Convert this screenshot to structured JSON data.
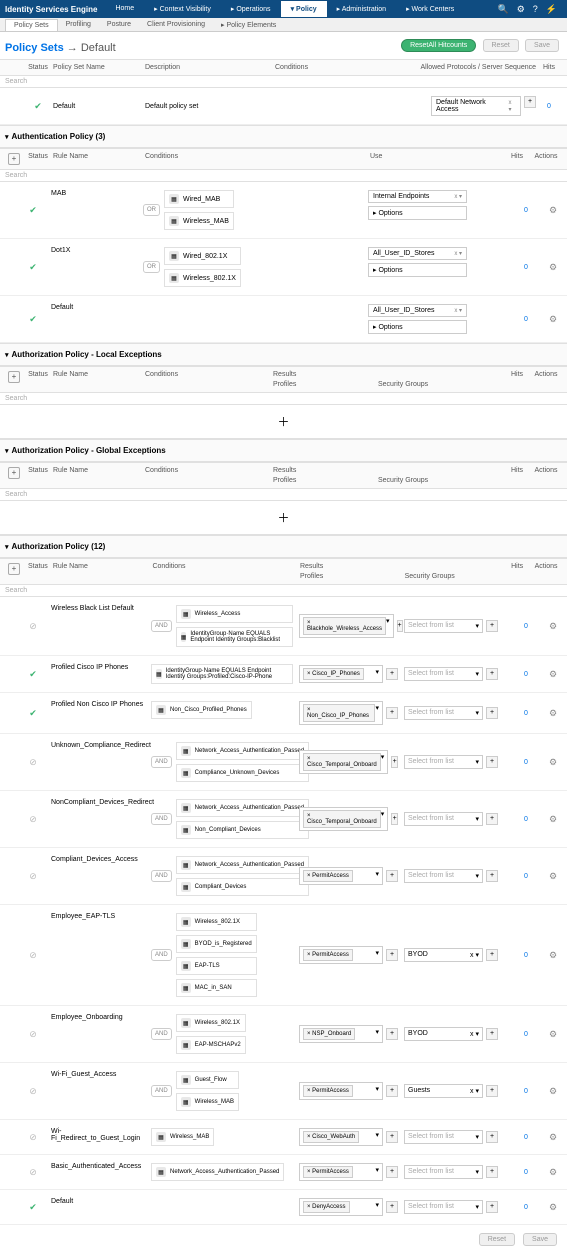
{
  "topbar": {
    "product": "Identity Services Engine",
    "nav": [
      "Home",
      "▸ Context Visibility",
      "▸ Operations",
      "▾ Policy",
      "▸ Administration",
      "▸ Work Centers"
    ]
  },
  "subnav": [
    "Policy Sets",
    "Profiling",
    "Posture",
    "Client Provisioning",
    "▸ Policy Elements"
  ],
  "title": {
    "main": "Policy Sets",
    "arrow": "→",
    "sub": "Default"
  },
  "buttons": {
    "resetHit": "ResetAll Hitcounts",
    "reset": "Reset",
    "save": "Save"
  },
  "headers": {
    "status": "Status",
    "psName": "Policy Set Name",
    "desc": "Description",
    "cond": "Conditions",
    "allowed": "Allowed Protocols / Server Sequence",
    "hits": "Hits",
    "ruleName": "Rule Name",
    "use": "Use",
    "actions": "Actions",
    "results": "Results",
    "profiles": "Profiles",
    "secGroups": "Security Groups",
    "search": "Search"
  },
  "defaultRow": {
    "name": "Default",
    "desc": "Default policy set",
    "allowed": "Default Network Access",
    "hits": "0"
  },
  "sections": {
    "authPolicy": "Authentication Policy (3)",
    "localEx": "Authorization Policy - Local Exceptions",
    "globalEx": "Authorization Policy - Global Exceptions",
    "authzPolicy": "Authorization Policy (12)"
  },
  "authRules": [
    {
      "name": "MAB",
      "conds": [
        "Wired_MAB",
        "Wireless_MAB"
      ],
      "op": "OR",
      "use": "Internal Endpoints",
      "options": "▸ Options",
      "hits": "0"
    },
    {
      "name": "Dot1X",
      "conds": [
        "Wired_802.1X",
        "Wireless_802.1X"
      ],
      "op": "OR",
      "use": "All_User_ID_Stores",
      "options": "▸ Options",
      "hits": "0"
    },
    {
      "name": "Default",
      "conds": [],
      "op": "",
      "use": "All_User_ID_Stores",
      "options": "▸ Options",
      "hits": "0"
    }
  ],
  "authzRules": [
    {
      "status": "gray",
      "name": "Wireless Black List Default",
      "op": "AND",
      "conds": [
        "Wireless_Access",
        "IdentityGroup·Name EQUALS Endpoint Identity Groups:Blacklist"
      ],
      "profile": "× Blackhole_Wireless_Access",
      "sec": "Select from list",
      "hits": "0"
    },
    {
      "status": "green",
      "name": "Profiled Cisco IP Phones",
      "op": "",
      "conds": [
        "IdentityGroup·Name EQUALS Endpoint Identity Groups:Profiled:Cisco-IP-Phone"
      ],
      "profile": "× Cisco_IP_Phones",
      "sec": "Select from list",
      "hits": "0"
    },
    {
      "status": "green",
      "name": "Profiled Non Cisco IP Phones",
      "op": "",
      "conds": [
        "Non_Cisco_Profiled_Phones"
      ],
      "profile": "× Non_Cisco_IP_Phones",
      "sec": "Select from list",
      "hits": "0"
    },
    {
      "status": "gray",
      "name": "Unknown_Compliance_Redirect",
      "op": "AND",
      "conds": [
        "Network_Access_Authentication_Passed",
        "Compliance_Unknown_Devices"
      ],
      "profile": "× Cisco_Temporal_Onboard",
      "sec": "Select from list",
      "hits": "0"
    },
    {
      "status": "gray",
      "name": "NonCompliant_Devices_Redirect",
      "op": "AND",
      "conds": [
        "Network_Access_Authentication_Passed",
        "Non_Compliant_Devices"
      ],
      "profile": "× Cisco_Temporal_Onboard",
      "sec": "Select from list",
      "hits": "0"
    },
    {
      "status": "gray",
      "name": "Compliant_Devices_Access",
      "op": "AND",
      "conds": [
        "Network_Access_Authentication_Passed",
        "Compliant_Devices"
      ],
      "profile": "× PermitAccess",
      "sec": "Select from list",
      "hits": "0"
    },
    {
      "status": "gray",
      "name": "Employee_EAP-TLS",
      "op": "AND",
      "conds": [
        "Wireless_802.1X",
        "BYOD_is_Registered",
        "EAP-TLS",
        "MAC_in_SAN"
      ],
      "profile": "× PermitAccess",
      "sec": "BYOD",
      "secClear": true,
      "hits": "0"
    },
    {
      "status": "gray",
      "name": "Employee_Onboarding",
      "op": "AND",
      "conds": [
        "Wireless_802.1X",
        "EAP-MSCHAPv2"
      ],
      "profile": "× NSP_Onboard",
      "sec": "BYOD",
      "secClear": true,
      "hits": "0"
    },
    {
      "status": "gray",
      "name": "Wi-Fi_Guest_Access",
      "op": "AND",
      "conds": [
        "Guest_Flow",
        "Wireless_MAB"
      ],
      "profile": "× PermitAccess",
      "sec": "Guests",
      "secClear": true,
      "hits": "0"
    },
    {
      "status": "gray",
      "name": "Wi-Fi_Redirect_to_Guest_Login",
      "op": "",
      "conds": [
        "Wireless_MAB"
      ],
      "profile": "× Cisco_WebAuth",
      "sec": "Select from list",
      "hits": "0"
    },
    {
      "status": "gray",
      "name": "Basic_Authenticated_Access",
      "op": "",
      "conds": [
        "Network_Access_Authentication_Passed"
      ],
      "profile": "× PermitAccess",
      "sec": "Select from list",
      "hits": "0"
    },
    {
      "status": "green",
      "name": "Default",
      "op": "",
      "conds": [],
      "profile": "× DenyAccess",
      "sec": "Select from list",
      "hits": "0"
    }
  ]
}
